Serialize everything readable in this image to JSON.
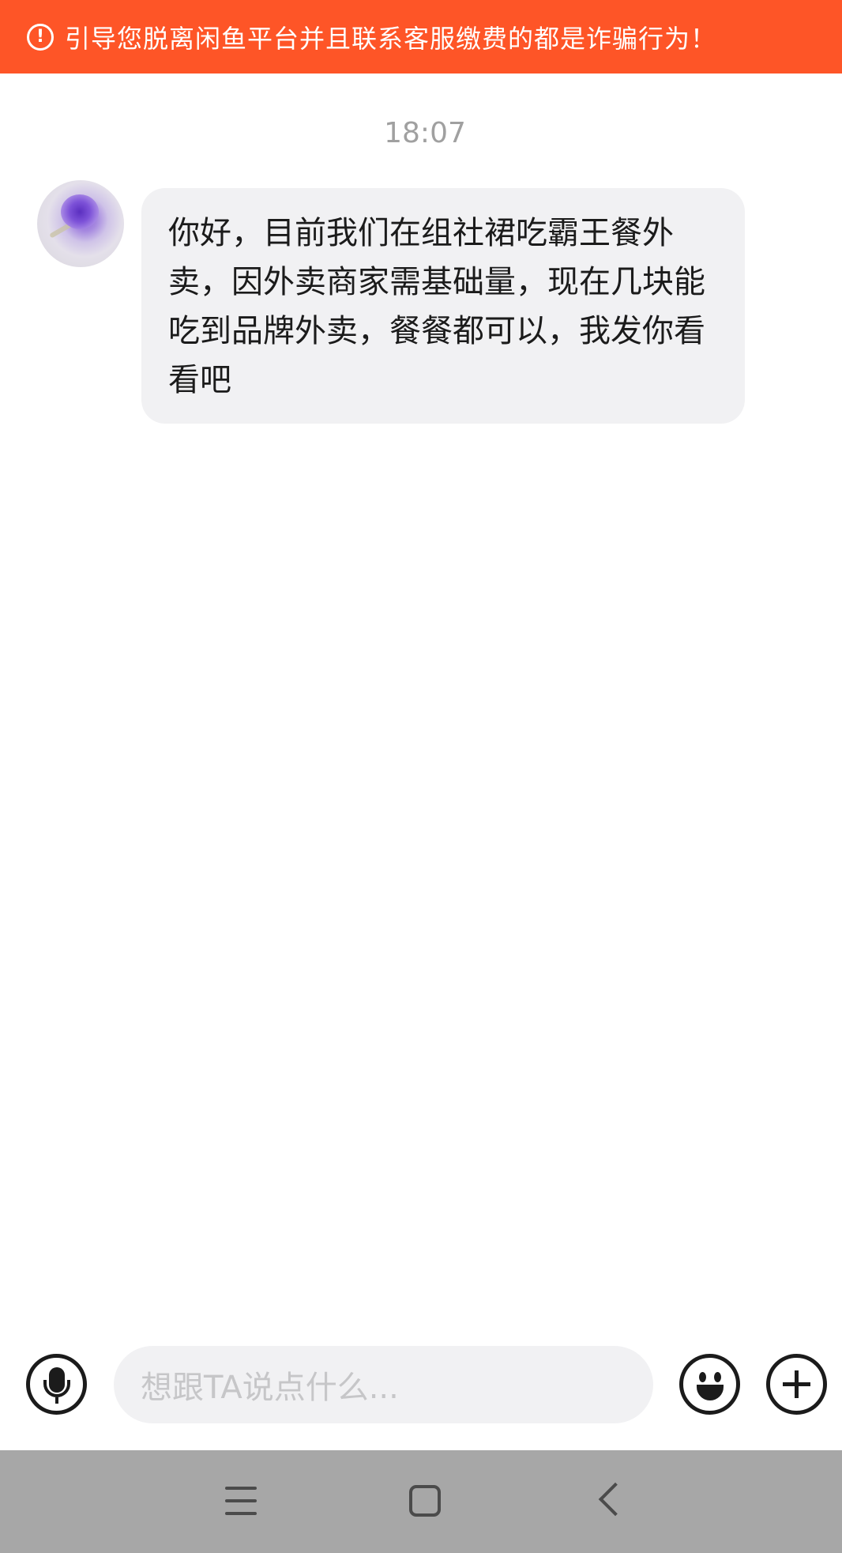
{
  "warning_banner": {
    "icon": "alert-circle-icon",
    "icon_glyph": "!",
    "text": "引导您脱离闲鱼平台并且联系客服缴费的都是诈骗行为！",
    "background_color": "#fe5527"
  },
  "chat": {
    "timestamp": "18:07",
    "messages": [
      {
        "sender": "other",
        "avatar": "avatar-purple-rose",
        "text": "你好，目前我们在组社裙吃霸王餐外卖，因外卖商家需基础量，现在几块能吃到品牌外卖，餐餐都可以，我发你看看吧"
      }
    ]
  },
  "input_bar": {
    "voice_icon": "microphone-icon",
    "placeholder": "想跟TA说点什么...",
    "emoji_icon": "emoji-smile-icon",
    "plus_icon": "plus-circle-icon"
  },
  "system_nav": {
    "menu_icon": "menu-icon",
    "home_icon": "home-square-icon",
    "back_icon": "back-chevron-icon"
  }
}
